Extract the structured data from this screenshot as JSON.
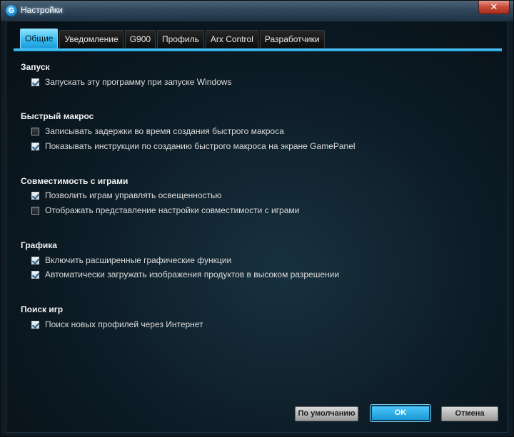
{
  "window": {
    "title": "Настройки",
    "close_label": "✕"
  },
  "tabs": [
    {
      "label": "Общие"
    },
    {
      "label": "Уведомление"
    },
    {
      "label": "G900"
    },
    {
      "label": "Профиль"
    },
    {
      "label": "Arx Control"
    },
    {
      "label": "Разработчики"
    }
  ],
  "sections": {
    "startup": {
      "title": "Запуск",
      "options": [
        {
          "label": "Запускать эту программу при запуске Windows",
          "checked": true
        }
      ]
    },
    "quick_macro": {
      "title": "Быстрый макрос",
      "options": [
        {
          "label": "Записывать задержки во время создания быстрого макроса",
          "checked": false
        },
        {
          "label": "Показывать инструкции по созданию быстрого макроса на экране GamePanel",
          "checked": true
        }
      ]
    },
    "game_compat": {
      "title": "Совместимость с играми",
      "options": [
        {
          "label": "Позволить играм управлять освещенностью",
          "checked": true
        },
        {
          "label": "Отображать представление настройки совместимости с играми",
          "checked": false
        }
      ]
    },
    "graphics": {
      "title": "Графика",
      "options": [
        {
          "label": "Включить расширенные графические функции",
          "checked": true
        },
        {
          "label": "Автоматически загружать изображения продуктов в высоком разрешении",
          "checked": true
        }
      ]
    },
    "game_search": {
      "title": "Поиск игр",
      "options": [
        {
          "label": "Поиск новых профилей через Интернет",
          "checked": true
        }
      ]
    }
  },
  "buttons": {
    "defaults": "По умолчанию",
    "ok": "OK",
    "cancel": "Отмена"
  }
}
